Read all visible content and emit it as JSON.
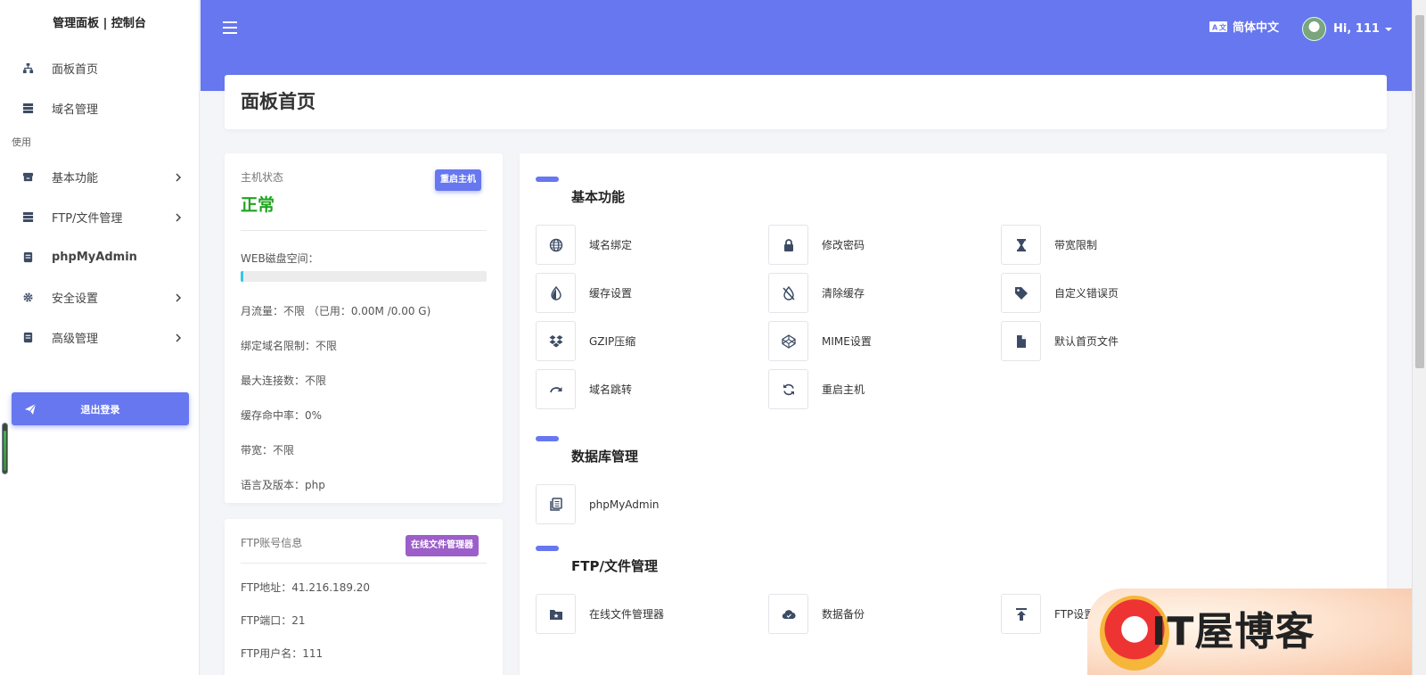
{
  "sidebar": {
    "brand": "管理面板 | 控制台",
    "items_top": [
      {
        "label": "面板首页",
        "icon": "sitemap-icon"
      },
      {
        "label": "域名管理",
        "icon": "server-icon"
      }
    ],
    "section_label": "使用",
    "items_use": [
      {
        "label": "基本功能",
        "icon": "archive-icon",
        "has_children": true
      },
      {
        "label": "FTP/文件管理",
        "icon": "server-icon",
        "has_children": true
      },
      {
        "label": "phpMyAdmin",
        "icon": "book-icon",
        "has_children": false
      },
      {
        "label": "安全设置",
        "icon": "gear-icon",
        "has_children": true
      },
      {
        "label": "高级管理",
        "icon": "book-icon",
        "has_children": true
      }
    ],
    "logout_label": "退出登录"
  },
  "topbar": {
    "language_label": "简体中文",
    "user_label": "Hi, 111"
  },
  "page_title": "面板首页",
  "host_status": {
    "title": "主机状态",
    "status": "正常",
    "restart_button": "重启主机",
    "disk_label": "WEB磁盘空间：",
    "disk_usage_fraction": 0.01,
    "rows": [
      "月流量：不限 （已用：0.00M /0.00 G)",
      "绑定域名限制：不限",
      "最大连接数：不限",
      "缓存命中率：0%",
      "带宽：不限",
      "语言及版本：php"
    ]
  },
  "ftp_info": {
    "title": "FTP账号信息",
    "file_manager_button": "在线文件管理器",
    "rows": [
      "FTP地址：41.216.189.20",
      "FTP端口：21",
      "FTP用户名：111"
    ]
  },
  "features": {
    "sections": [
      {
        "title": "基本功能",
        "tiles": [
          {
            "label": "域名绑定",
            "icon": "globe-icon"
          },
          {
            "label": "修改密码",
            "icon": "lock-icon"
          },
          {
            "label": "带宽限制",
            "icon": "hourglass-icon"
          },
          {
            "label": "缓存设置",
            "icon": "tint-icon"
          },
          {
            "label": "清除缓存",
            "icon": "tint-slash-icon"
          },
          {
            "label": "自定义错误页",
            "icon": "tag-icon"
          },
          {
            "label": "GZIP压缩",
            "icon": "dropbox-icon"
          },
          {
            "label": "MIME设置",
            "icon": "codepen-icon"
          },
          {
            "label": "默认首页文件",
            "icon": "file-icon"
          },
          {
            "label": "域名跳转",
            "icon": "redo-icon"
          },
          {
            "label": "重启主机",
            "icon": "sync-icon"
          }
        ]
      },
      {
        "title": "数据库管理",
        "tiles": [
          {
            "label": "phpMyAdmin",
            "icon": "book-icon"
          }
        ]
      },
      {
        "title": "FTP/文件管理",
        "tiles": [
          {
            "label": "在线文件管理器",
            "icon": "folder-star-icon"
          },
          {
            "label": "数据备份",
            "icon": "cloud-icon"
          },
          {
            "label": "FTP设置",
            "icon": "upload-icon"
          }
        ]
      }
    ]
  },
  "watermark": {
    "text": "IT屋博客"
  },
  "colors": {
    "accent": "#6777ef",
    "status_ok": "#1fa51f",
    "file_manager_button": "#9c5fc9"
  }
}
